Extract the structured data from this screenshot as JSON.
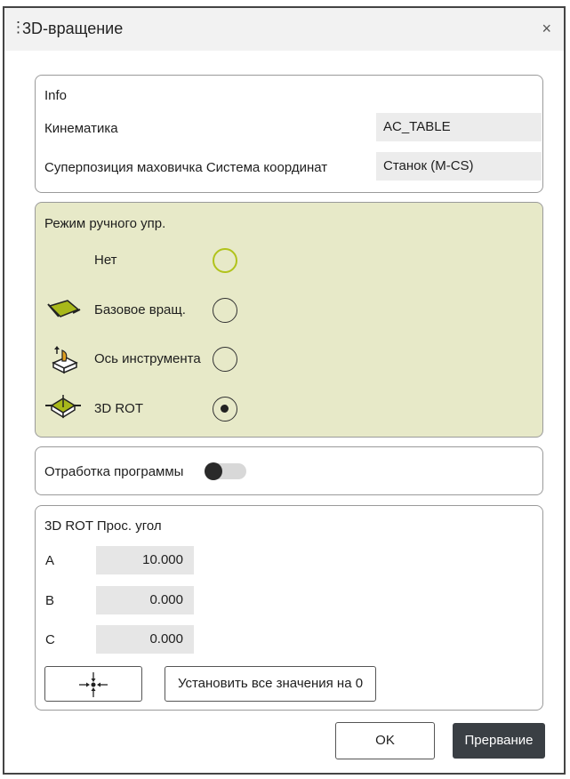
{
  "window": {
    "title": "3D-вращение",
    "drag_handle": "⋮",
    "close": "×"
  },
  "info": {
    "header": "Info",
    "rows": [
      {
        "label": "Кинематика",
        "value": "AC_TABLE"
      },
      {
        "label": "Суперпозиция маховичка Система координат",
        "value": "Станок (M-CS)"
      }
    ]
  },
  "mode": {
    "header": "Режим ручного упр.",
    "options": [
      {
        "label": "Нет",
        "selected": false,
        "icon": "none"
      },
      {
        "label": "Базовое вращ.",
        "selected": false,
        "icon": "basic-rotation-icon"
      },
      {
        "label": "Ось инструмента",
        "selected": false,
        "icon": "tool-axis-icon"
      },
      {
        "label": "3D ROT",
        "selected": true,
        "icon": "3d-rot-icon"
      }
    ],
    "accent_color": "#b1c31b",
    "background_color": "#e7e9c8"
  },
  "program_run": {
    "label": "Отработка программы",
    "enabled": false
  },
  "angles": {
    "header": "3D ROT Прос. угол",
    "rows": [
      {
        "axis": "A",
        "value": "10.000"
      },
      {
        "axis": "B",
        "value": "0.000"
      },
      {
        "axis": "C",
        "value": "0.000"
      }
    ],
    "reset_all_label": "Установить все значения на 0",
    "crosshair_icon": "crosshair-icon"
  },
  "footer": {
    "ok_label": "OK",
    "cancel_label": "Прервание"
  }
}
